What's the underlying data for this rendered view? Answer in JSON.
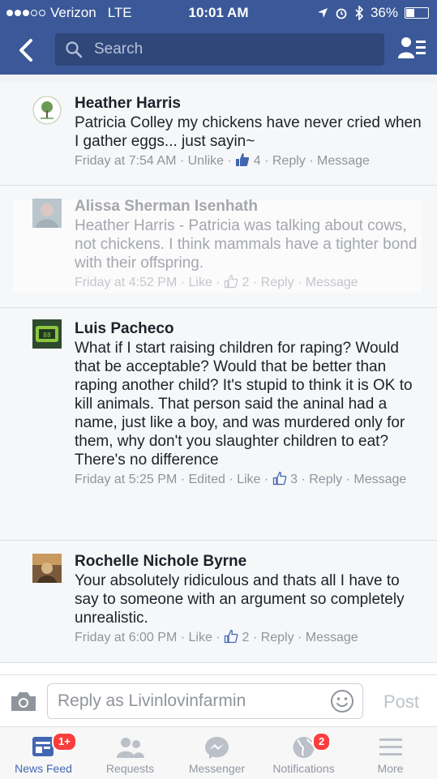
{
  "status_bar": {
    "carrier": "Verizon",
    "network": "LTE",
    "time": "10:01 AM",
    "battery": "36%"
  },
  "header": {
    "search_placeholder": "Search"
  },
  "comments": [
    {
      "author": "Heather Harris",
      "text": "Patricia Colley my chickens have never cried when I gather eggs... just sayin~",
      "time": "Friday at 7:54 AM",
      "action": "Unlike",
      "likes": "4",
      "reply": "Reply",
      "message": "Message"
    },
    {
      "author": "Alissa Sherman Isenhath",
      "text": "Heather Harris - Patricia was talking about cows, not chickens. I think mammals have a tighter bond with their offspring.",
      "time": "Friday at 4:52 PM",
      "action": "Like",
      "likes": "2",
      "reply": "Reply",
      "message": "Message"
    },
    {
      "author": "Luis Pacheco",
      "text": "What if I start raising children for raping? Would that be acceptable? Would that be better than raping another child? It's stupid to think it is OK to kill animals. That person said the aninal had a name, just like a boy, and was murdered only for them, why don't you slaughter children to eat? There's no difference",
      "time": "Friday at 5:25 PM",
      "edited": "Edited",
      "action": "Like",
      "likes": "3",
      "reply": "Reply",
      "message": "Message"
    },
    {
      "author": "Rochelle Nichole Byrne",
      "text": "Your absolutely ridiculous and thats all I have to say to someone with an argument so completely unrealistic.",
      "time": "Friday at 6:00 PM",
      "action": "Like",
      "likes": "2",
      "reply": "Reply",
      "message": "Message"
    }
  ],
  "reply_bar": {
    "placeholder": "Reply as Livinlovinfarmin",
    "post_label": "Post"
  },
  "tabs": [
    {
      "label": "News Feed",
      "badge": "1+"
    },
    {
      "label": "Requests"
    },
    {
      "label": "Messenger"
    },
    {
      "label": "Notifications",
      "badge": "2"
    },
    {
      "label": "More"
    }
  ],
  "colors": {
    "brand": "#3b5998",
    "badge": "#fa3e3e",
    "active_tab": "#4267b2"
  }
}
